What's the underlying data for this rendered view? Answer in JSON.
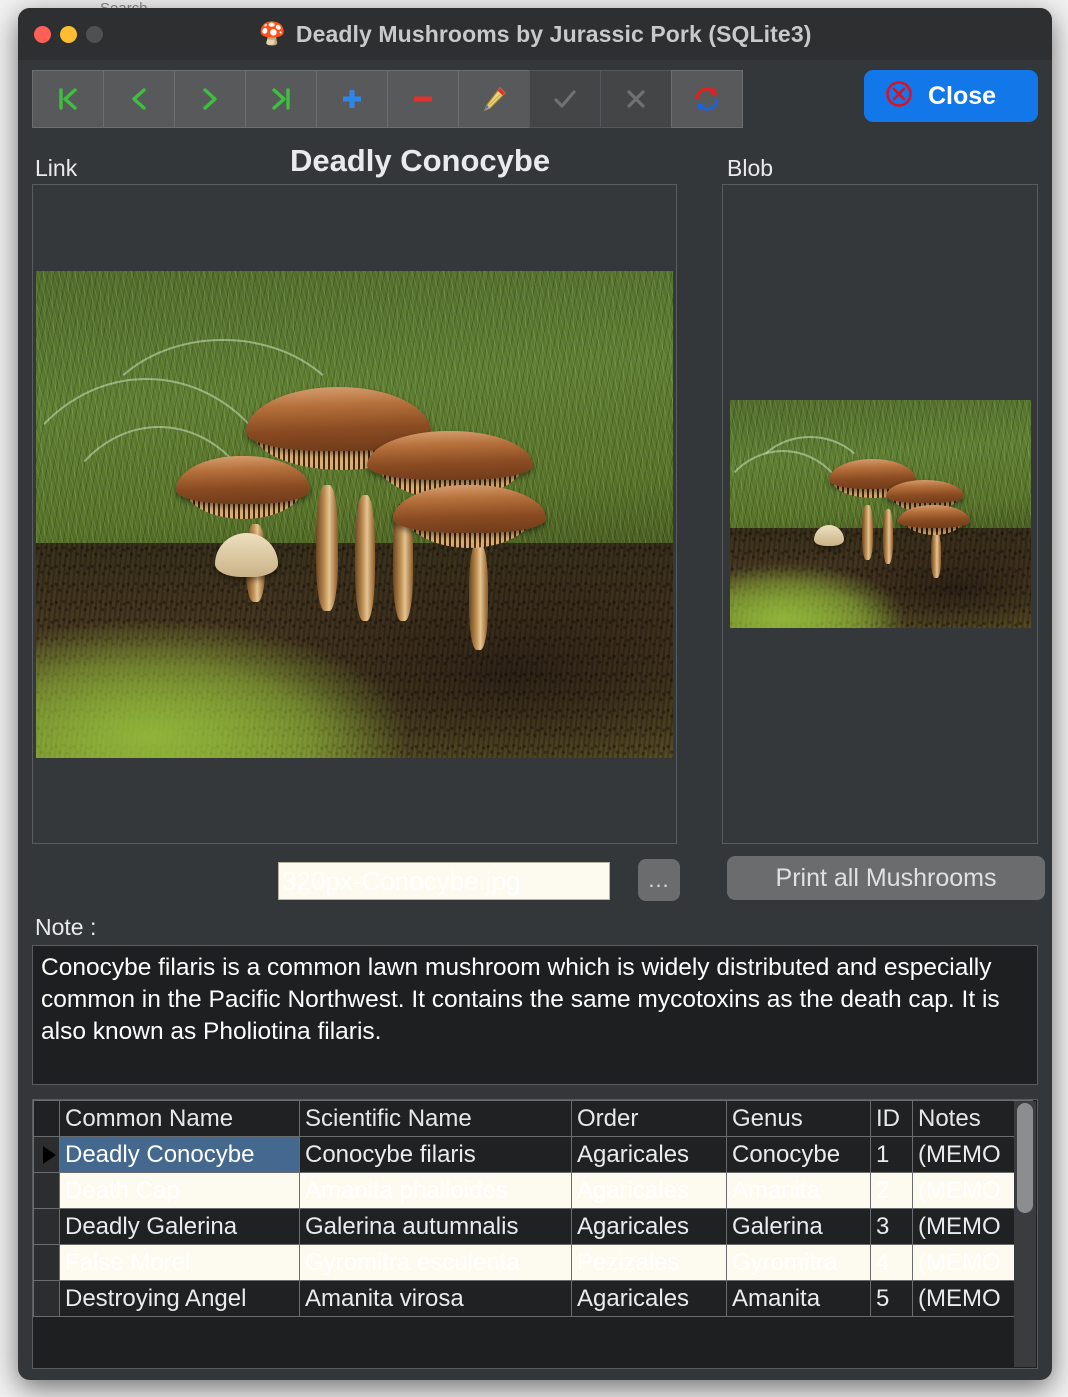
{
  "desktop": {
    "ghost_text": "Search"
  },
  "window": {
    "title": "Deadly Mushrooms by Jurassic Pork (SQLite3)",
    "title_icon": "mushroom-icon",
    "traffic_lights": [
      {
        "name": "close",
        "color": "#ff5f57"
      },
      {
        "name": "minimize",
        "color": "#febc2e"
      },
      {
        "name": "zoom",
        "color": "#4e5052"
      }
    ]
  },
  "toolbar": {
    "buttons": [
      {
        "name": "first-record",
        "icon": "first-record-icon",
        "enabled": true
      },
      {
        "name": "previous-record",
        "icon": "previous-record-icon",
        "enabled": true
      },
      {
        "name": "next-record",
        "icon": "next-record-icon",
        "enabled": true
      },
      {
        "name": "last-record",
        "icon": "last-record-icon",
        "enabled": true
      },
      {
        "name": "add-record",
        "icon": "plus-icon",
        "enabled": true
      },
      {
        "name": "delete-record",
        "icon": "minus-icon",
        "enabled": true
      },
      {
        "name": "edit-record",
        "icon": "pencil-icon",
        "enabled": true
      },
      {
        "name": "commit-edit",
        "icon": "check-icon",
        "enabled": false
      },
      {
        "name": "cancel-edit",
        "icon": "x-icon",
        "enabled": false
      },
      {
        "name": "refresh",
        "icon": "refresh-icon",
        "enabled": true
      }
    ],
    "close_label": "Close",
    "close_icon": "circle-x-icon",
    "close_color": "#1277e8"
  },
  "form": {
    "link_label": "Link",
    "blob_label": "Blob",
    "record_title": "Deadly Conocybe",
    "file_field_value": "320px-Conocybe.jpg",
    "file_field_placeholder": "",
    "browse_label": "...",
    "print_label": "Print all Mushrooms",
    "note_label": "Note :",
    "note_text": "Conocybe filaris is a common lawn mushroom which is widely distributed and especially common in the Pacific Northwest. It contains the same mycotoxins as the death cap. It is also known as Pholiotina filaris."
  },
  "grid": {
    "columns": [
      "",
      "Common Name",
      "Scientific Name",
      "Order",
      "Genus",
      "ID",
      "Notes"
    ],
    "selected_row": 0,
    "selected_column": "Common Name",
    "rows": [
      {
        "indicator": "row-indicator-triangle",
        "common_name": "Deadly Conocybe",
        "scientific_name": "Conocybe filaris",
        "order": "Agaricales",
        "genus": "Conocybe",
        "id": "1",
        "notes": "(MEMO"
      },
      {
        "indicator": "",
        "common_name": "Death Cap",
        "scientific_name": "Amanita phalloides",
        "order": "Agaricales",
        "genus": "Amanita",
        "id": "2",
        "notes": "(MEMO"
      },
      {
        "indicator": "",
        "common_name": "Deadly Galerina",
        "scientific_name": "Galerina autumnalis",
        "order": "Agaricales",
        "genus": "Galerina",
        "id": "3",
        "notes": "(MEMO"
      },
      {
        "indicator": "",
        "common_name": "False Morel",
        "scientific_name": "Gyromitra esculenta",
        "order": "Pezizales",
        "genus": "Gyromitra",
        "id": "4",
        "notes": "(MEMO"
      },
      {
        "indicator": "",
        "common_name": "Destroying Angel",
        "scientific_name": "Amanita virosa",
        "order": "Agaricales",
        "genus": "Amanita",
        "id": "5",
        "notes": "(MEMO"
      }
    ]
  }
}
